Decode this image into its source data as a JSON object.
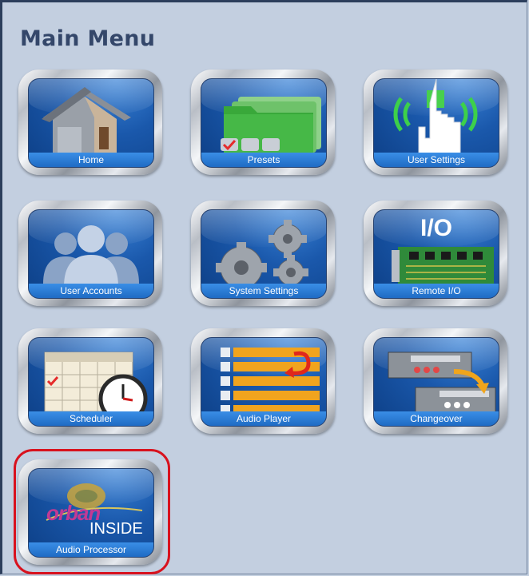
{
  "header": {
    "title": "Main Menu"
  },
  "menu": {
    "home": {
      "label": "Home",
      "icon": "house-icon"
    },
    "presets": {
      "label": "Presets",
      "icon": "folders-icon"
    },
    "user_settings": {
      "label": "User Settings",
      "icon": "touch-hand-icon"
    },
    "user_accounts": {
      "label": "User Accounts",
      "icon": "users-icon"
    },
    "system_settings": {
      "label": "System Settings",
      "icon": "gears-icon"
    },
    "remote_io": {
      "label": "Remote I/O",
      "icon": "circuit-board-icon",
      "badge": "I/O"
    },
    "scheduler": {
      "label": "Scheduler",
      "icon": "calendar-clock-icon"
    },
    "audio_player": {
      "label": "Audio Player",
      "icon": "playlist-icon"
    },
    "changeover": {
      "label": "Changeover",
      "icon": "rack-transfer-icon"
    },
    "audio_processor": {
      "label": "Audio Processor",
      "icon": "orban-logo-icon",
      "logo_text": "orban",
      "logo_sub": "INSIDE"
    }
  },
  "colors": {
    "accent": "#1f6bc4",
    "highlight": "#d8121e",
    "background": "#c3cfe0"
  }
}
